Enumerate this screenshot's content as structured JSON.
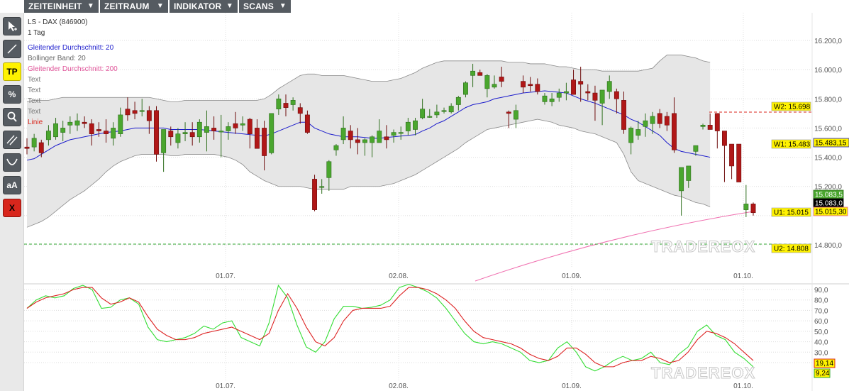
{
  "menu": {
    "items": [
      {
        "label": "ZEITEINHEIT"
      },
      {
        "label": "ZEITRAUM"
      },
      {
        "label": "INDIKATOR"
      },
      {
        "label": "SCANS"
      }
    ]
  },
  "toolbar": {
    "tp_label": "TP",
    "percent_label": "%",
    "text_label": "aA",
    "delete_label": "X"
  },
  "chart_header": {
    "instrument": "LS - DAX (846900)",
    "interval": "1 Tag"
  },
  "legend": {
    "items": [
      {
        "label": "Gleitender Durchschnitt: 20",
        "color": "#1c1ccc"
      },
      {
        "label": "Bollinger Band: 20",
        "color": "#666666"
      },
      {
        "label": "Gleitender Durchschnitt: 200",
        "color": "#e0559a"
      },
      {
        "label": "Text",
        "color": "#777777"
      },
      {
        "label": "Text",
        "color": "#777777"
      },
      {
        "label": "Text",
        "color": "#777777"
      },
      {
        "label": "Text",
        "color": "#777777"
      },
      {
        "label": "Linie",
        "color": "#d8261c"
      }
    ]
  },
  "watermark": "TRADEREOX",
  "colors": {
    "up": "#4aa62e",
    "down": "#b01717",
    "ma20": "#1c1ccc",
    "ma200": "#f070b0",
    "band_fill": "#e6e6e6",
    "band_line": "#8a8a8a",
    "stoch_k": "#33dd33",
    "stoch_d": "#dd2222"
  },
  "chart_data": [
    {
      "type": "candlestick",
      "y_ticks": [
        "16.200,0",
        "16.000,0",
        "15.800,0",
        "15.600,0",
        "15.400,0",
        "15.200,0",
        "14.800,0"
      ],
      "x_ticks": [
        "01.07.",
        "02.08.",
        "01.09.",
        "01.10."
      ],
      "ylim": [
        14700,
        16300
      ],
      "candles": [
        [
          15470,
          15530,
          15420,
          15460
        ],
        [
          15470,
          15560,
          15440,
          15530
        ],
        [
          15500,
          15520,
          15400,
          15430
        ],
        [
          15520,
          15620,
          15480,
          15580
        ],
        [
          15540,
          15670,
          15520,
          15630
        ],
        [
          15570,
          15650,
          15510,
          15600
        ],
        [
          15620,
          15680,
          15560,
          15640
        ],
        [
          15620,
          15700,
          15580,
          15650
        ],
        [
          15640,
          15680,
          15600,
          15630
        ],
        [
          15630,
          15660,
          15480,
          15560
        ],
        [
          15590,
          15640,
          15540,
          15580
        ],
        [
          15580,
          15660,
          15500,
          15560
        ],
        [
          15530,
          15640,
          15480,
          15600
        ],
        [
          15560,
          15740,
          15540,
          15690
        ],
        [
          15730,
          15810,
          15650,
          15690
        ],
        [
          15720,
          15780,
          15660,
          15700
        ],
        [
          15720,
          15800,
          15680,
          15720
        ],
        [
          15720,
          15750,
          15560,
          15650
        ],
        [
          15720,
          15750,
          15370,
          15420
        ],
        [
          15430,
          15580,
          15300,
          15590
        ],
        [
          15580,
          15610,
          15480,
          15540
        ],
        [
          15500,
          15600,
          15460,
          15560
        ],
        [
          15560,
          15640,
          15510,
          15570
        ],
        [
          15570,
          15640,
          15480,
          15540
        ],
        [
          15540,
          15660,
          15500,
          15640
        ],
        [
          15570,
          15720,
          15440,
          15610
        ],
        [
          15600,
          15680,
          15520,
          15580
        ],
        [
          15580,
          15690,
          15400,
          15580
        ],
        [
          15580,
          15640,
          15520,
          15610
        ],
        [
          15630,
          15710,
          15560,
          15600
        ],
        [
          15620,
          15680,
          15580,
          15630
        ],
        [
          15660,
          15670,
          15460,
          15560
        ],
        [
          15600,
          15660,
          15470,
          15460
        ],
        [
          15600,
          15650,
          15310,
          15410
        ],
        [
          15430,
          15640,
          15420,
          15700
        ],
        [
          15730,
          15830,
          15690,
          15800
        ],
        [
          15770,
          15830,
          15680,
          15740
        ],
        [
          15760,
          15810,
          15720,
          15790
        ],
        [
          15740,
          15770,
          15630,
          15700
        ],
        [
          15690,
          15720,
          15560,
          15570
        ],
        [
          15250,
          15280,
          15030,
          15040
        ],
        [
          15200,
          15250,
          15150,
          15200
        ],
        [
          15260,
          15380,
          15170,
          15370
        ],
        [
          15450,
          15490,
          15410,
          15480
        ],
        [
          15520,
          15680,
          15490,
          15600
        ],
        [
          15580,
          15620,
          15460,
          15520
        ],
        [
          15520,
          15600,
          15420,
          15500
        ],
        [
          15500,
          15530,
          15410,
          15520
        ],
        [
          15500,
          15550,
          15400,
          15540
        ],
        [
          15500,
          15660,
          15500,
          15580
        ],
        [
          15540,
          15620,
          15460,
          15520
        ],
        [
          15550,
          15590,
          15500,
          15570
        ],
        [
          15570,
          15610,
          15520,
          15570
        ],
        [
          15580,
          15670,
          15550,
          15640
        ],
        [
          15590,
          15670,
          15550,
          15650
        ],
        [
          15670,
          15800,
          15660,
          15730
        ],
        [
          15680,
          15730,
          15670,
          15680
        ],
        [
          15690,
          15760,
          15670,
          15710
        ],
        [
          15720,
          15740,
          15700,
          15720
        ],
        [
          15710,
          15770,
          15700,
          15750
        ],
        [
          15760,
          15820,
          15720,
          15810
        ],
        [
          15830,
          15920,
          15810,
          15910
        ],
        [
          15960,
          16040,
          15880,
          15990
        ],
        [
          15980,
          16000,
          15960,
          15960
        ],
        [
          15870,
          15970,
          15810,
          15960
        ],
        [
          15880,
          15960,
          15870,
          15900
        ],
        [
          15950,
          16020,
          15880,
          15920
        ],
        [
          15710,
          15720,
          15600,
          15700
        ],
        [
          15660,
          15760,
          15600,
          15720
        ],
        [
          15920,
          15960,
          15840,
          15880
        ],
        [
          15900,
          15950,
          15850,
          15890
        ],
        [
          15900,
          15940,
          15830,
          15850
        ],
        [
          15780,
          15840,
          15760,
          15820
        ],
        [
          15780,
          15840,
          15750,
          15800
        ],
        [
          15810,
          15870,
          15780,
          15840
        ],
        [
          15840,
          15910,
          15790,
          15850
        ],
        [
          15930,
          16000,
          15850,
          15830
        ],
        [
          15920,
          16020,
          15780,
          15900
        ],
        [
          15850,
          15900,
          15790,
          15840
        ],
        [
          15840,
          15890,
          15650,
          15790
        ],
        [
          15770,
          15850,
          15620,
          15860
        ],
        [
          15850,
          15960,
          15800,
          15920
        ],
        [
          15850,
          15870,
          15700,
          15800
        ],
        [
          15790,
          15850,
          15560,
          15590
        ],
        [
          15500,
          15610,
          15420,
          15600
        ],
        [
          15550,
          15650,
          15520,
          15590
        ],
        [
          15610,
          15700,
          15540,
          15650
        ],
        [
          15630,
          15710,
          15560,
          15680
        ],
        [
          15700,
          15730,
          15600,
          15630
        ],
        [
          15680,
          15710,
          15580,
          15620
        ],
        [
          15700,
          15810,
          15430,
          15450
        ],
        [
          15170,
          15290,
          15000,
          15330
        ],
        [
          15240,
          15330,
          15190,
          15340
        ],
        [
          15440,
          15480,
          15410,
          15480
        ],
        [
          15610,
          15630,
          15590,
          15620
        ],
        [
          15620,
          15700,
          15590,
          15590
        ],
        [
          15700,
          15700,
          15460,
          15580
        ],
        [
          15580,
          15490,
          15230,
          15480
        ],
        [
          15490,
          15460,
          15250,
          15340
        ],
        [
          15490,
          15490,
          15230,
          15230
        ],
        [
          15040,
          15210,
          14990,
          15080
        ],
        [
          15080,
          15090,
          15000,
          15020
        ]
      ],
      "ma20": [
        15380,
        15390,
        15420,
        15450,
        15480,
        15500,
        15520,
        15530,
        15540,
        15550,
        15560,
        15570,
        15575,
        15580,
        15590,
        15600,
        15600,
        15600,
        15600,
        15600,
        15590,
        15590,
        15590,
        15590,
        15590,
        15585,
        15580,
        15575,
        15570,
        15565,
        15560,
        15555,
        15550,
        15545,
        15560,
        15580,
        15600,
        15620,
        15640,
        15640,
        15600,
        15580,
        15560,
        15550,
        15540,
        15540,
        15540,
        15535,
        15530,
        15530,
        15535,
        15540,
        15545,
        15550,
        15555,
        15580,
        15600,
        15630,
        15650,
        15680,
        15710,
        15740,
        15760,
        15770,
        15780,
        15800,
        15810,
        15820,
        15830,
        15840,
        15845,
        15850,
        15855,
        15850,
        15845,
        15840,
        15820,
        15800,
        15785,
        15770,
        15750,
        15730,
        15710,
        15690,
        15660,
        15640,
        15610,
        15580,
        15550,
        15500,
        15460,
        15440,
        15430,
        15420,
        15410,
        15400
      ],
      "ma200_from_x": 670,
      "band_upper": [
        15780,
        15790,
        15790,
        15790,
        15800,
        15810,
        15810,
        15810,
        15810,
        15810,
        15810,
        15810,
        15810,
        15810,
        15810,
        15810,
        15810,
        15810,
        15800,
        15790,
        15780,
        15780,
        15790,
        15790,
        15790,
        15790,
        15790,
        15790,
        15790,
        15790,
        15790,
        15790,
        15790,
        15800,
        15830,
        15870,
        15900,
        15930,
        15960,
        15970,
        15970,
        15960,
        15960,
        15960,
        15960,
        15950,
        15940,
        15930,
        15920,
        15920,
        15920,
        15930,
        15940,
        15960,
        15980,
        16010,
        16030,
        16050,
        16060,
        16060,
        16060,
        16060,
        16060,
        16060,
        16060,
        16060,
        16060,
        16050,
        16050,
        16050,
        16040,
        16040,
        16040,
        16030,
        16020,
        16020,
        16010,
        16000,
        16000,
        16000,
        15990,
        15990,
        15990,
        15990,
        15990,
        15990,
        16000,
        16010,
        16060,
        16100,
        16100,
        16100,
        16090,
        16080,
        16060,
        16050
      ],
      "band_lower": [
        14920,
        14940,
        14960,
        14990,
        15030,
        15070,
        15110,
        15140,
        15170,
        15210,
        15250,
        15300,
        15340,
        15370,
        15390,
        15410,
        15420,
        15420,
        15420,
        15420,
        15410,
        15410,
        15420,
        15420,
        15420,
        15420,
        15420,
        15410,
        15400,
        15380,
        15350,
        15300,
        15270,
        15240,
        15220,
        15200,
        15200,
        15200,
        15200,
        15190,
        15180,
        15180,
        15180,
        15180,
        15180,
        15200,
        15200,
        15200,
        15200,
        15200,
        15210,
        15220,
        15240,
        15260,
        15280,
        15310,
        15340,
        15370,
        15400,
        15430,
        15460,
        15500,
        15530,
        15560,
        15590,
        15600,
        15610,
        15620,
        15630,
        15640,
        15650,
        15660,
        15650,
        15640,
        15620,
        15610,
        15600,
        15580,
        15570,
        15560,
        15540,
        15520,
        15500,
        15420,
        15300,
        15240,
        15220,
        15200,
        15180,
        15160,
        15140,
        15130,
        15110,
        15090,
        15080,
        15060
      ]
    },
    {
      "type": "line",
      "y_ticks": [
        "90,0",
        "80,0",
        "70,0",
        "60,0",
        "50,0",
        "40,0",
        "30,0",
        "20,0"
      ],
      "x_ticks": [
        "01.07.",
        "02.08.",
        "01.09.",
        "01.10."
      ],
      "ylim": [
        0,
        95
      ],
      "series": [
        {
          "values": [
            72,
            80,
            84,
            82,
            84,
            91,
            94,
            90,
            72,
            73,
            80,
            82,
            76,
            54,
            42,
            40,
            42,
            44,
            48,
            55,
            52,
            58,
            60,
            44,
            40,
            36,
            58,
            94,
            82,
            56,
            35,
            30,
            40,
            62,
            74,
            74,
            72,
            73,
            75,
            80,
            92,
            95,
            92,
            88,
            82,
            72,
            60,
            48,
            40,
            38,
            40,
            38,
            34,
            30,
            22,
            20,
            22,
            34,
            40,
            30,
            16,
            12,
            16,
            22,
            26,
            22,
            24,
            30,
            20,
            18,
            28,
            35,
            50,
            56,
            46,
            42,
            30,
            24,
            16
          ]
        },
        {
          "values": [
            72,
            78,
            82,
            84,
            86,
            90,
            92,
            92,
            82,
            76,
            78,
            82,
            78,
            64,
            52,
            46,
            42,
            42,
            44,
            48,
            50,
            52,
            54,
            50,
            46,
            42,
            48,
            70,
            86,
            72,
            54,
            40,
            36,
            44,
            60,
            70,
            72,
            72,
            72,
            74,
            84,
            92,
            92,
            90,
            86,
            80,
            72,
            60,
            50,
            44,
            42,
            40,
            38,
            34,
            28,
            24,
            22,
            26,
            34,
            34,
            28,
            20,
            16,
            16,
            20,
            22,
            22,
            26,
            24,
            20,
            22,
            30,
            42,
            50,
            48,
            44,
            38,
            30,
            22
          ]
        }
      ],
      "labels": [
        "19,14",
        "9,24"
      ]
    }
  ],
  "price_tags": [
    {
      "label": "W2: 15.698"
    },
    {
      "label": "W1: 15.483"
    },
    {
      "label": "U1: 15.015"
    },
    {
      "label": "U2: 14.808"
    }
  ],
  "axis_tags": [
    {
      "label": "15.483,15"
    },
    {
      "label": "15.083,5"
    },
    {
      "label": "15.083,0"
    },
    {
      "label": "15.015,30"
    }
  ]
}
